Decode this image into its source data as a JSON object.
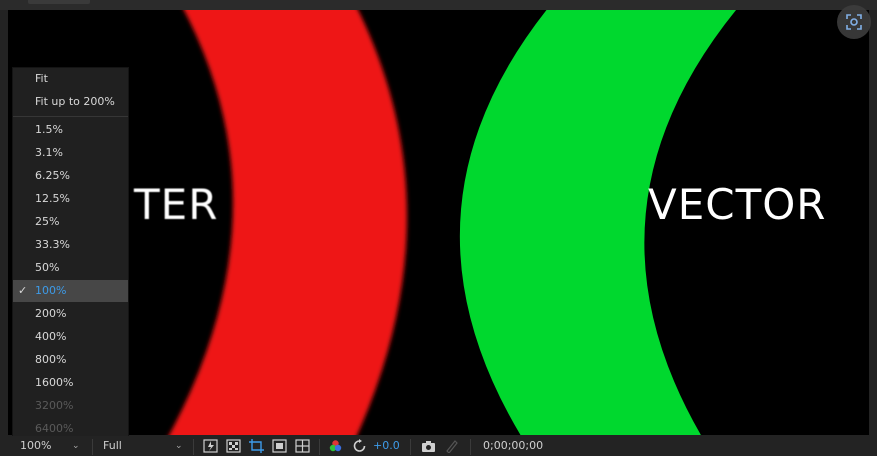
{
  "menu": {
    "fit_items": [
      "Fit",
      "Fit up to 200%"
    ],
    "zoom_items": [
      "1.5%",
      "3.1%",
      "6.25%",
      "12.5%",
      "25%",
      "33.3%",
      "50%",
      "100%",
      "200%",
      "400%",
      "800%",
      "1600%",
      "3200%",
      "6400%"
    ],
    "selected": "100%",
    "disabled": [
      "3200%",
      "6400%"
    ]
  },
  "canvas": {
    "raster_text": "TER",
    "vector_text": "VECTOR",
    "colors": {
      "background": "#000000",
      "red_ring": "#ee1818",
      "green_ring": "#00d82e",
      "text": "#ffffff"
    }
  },
  "footer": {
    "zoom_label": "100%",
    "resolution_label": "Full",
    "exposure": "+0.0",
    "timecode": "0;00;00;00"
  },
  "colors": {
    "accent": "#3d9be9",
    "panel": "#232323",
    "menu_bg": "#202020",
    "menu_highlight": "#474747"
  }
}
